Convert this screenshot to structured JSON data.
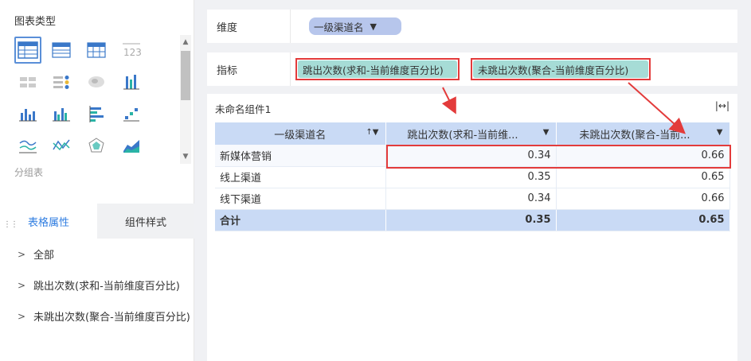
{
  "left_panel": {
    "title": "图表类型",
    "selected_chart_caption": "分组表",
    "tabs": [
      {
        "label": "表格属性",
        "active": true
      },
      {
        "label": "组件样式",
        "active": false
      }
    ],
    "props": [
      "全部",
      "跳出次数(求和-当前维度百分比)",
      "未跳出次数(聚合-当前维度百分比)"
    ]
  },
  "dimension_bar": {
    "label": "维度",
    "chip": "一级渠道名"
  },
  "metric_bar": {
    "label": "指标",
    "chips": [
      "跳出次数(求和-当前维度百分比)",
      "未跳出次数(聚合-当前维度百分比)"
    ]
  },
  "widget": {
    "title": "未命名组件1",
    "columns": [
      "一级渠道名",
      "跳出次数(求和-当前维...",
      "未跳出次数(聚合-当前..."
    ],
    "rows": [
      {
        "name": "新媒体营销",
        "v1": "0.34",
        "v2": "0.66"
      },
      {
        "name": "线上渠道",
        "v1": "0.35",
        "v2": "0.65"
      },
      {
        "name": "线下渠道",
        "v1": "0.34",
        "v2": "0.66"
      }
    ],
    "total": {
      "name": "合计",
      "v1": "0.35",
      "v2": "0.65"
    }
  },
  "colors": {
    "accent": "#2f7de1",
    "dim_chip": "#b7c6ec",
    "metric_chip": "#a6dcd6",
    "header_bg": "#c9daf5",
    "highlight": "#e33b3b"
  }
}
